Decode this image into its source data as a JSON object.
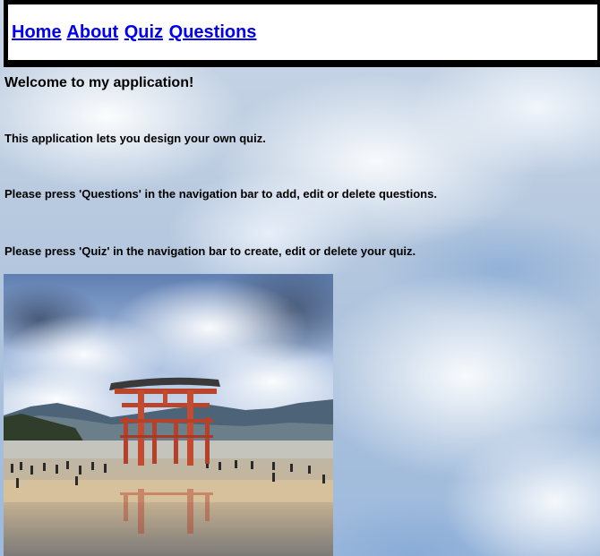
{
  "nav": {
    "items": [
      {
        "label": "Home"
      },
      {
        "label": "About"
      },
      {
        "label": "Quiz"
      },
      {
        "label": "Questions"
      }
    ],
    "link_color": "#0000ee"
  },
  "main": {
    "heading": "Welcome to my application!",
    "paragraphs": [
      "This application lets you design your own quiz.",
      "Please press 'Questions' in the navigation bar to add, edit or delete questions.",
      "Please press 'Quiz' in the navigation bar to create, edit or delete your quiz."
    ]
  },
  "image": {
    "subject": "torii-gate-photo"
  }
}
